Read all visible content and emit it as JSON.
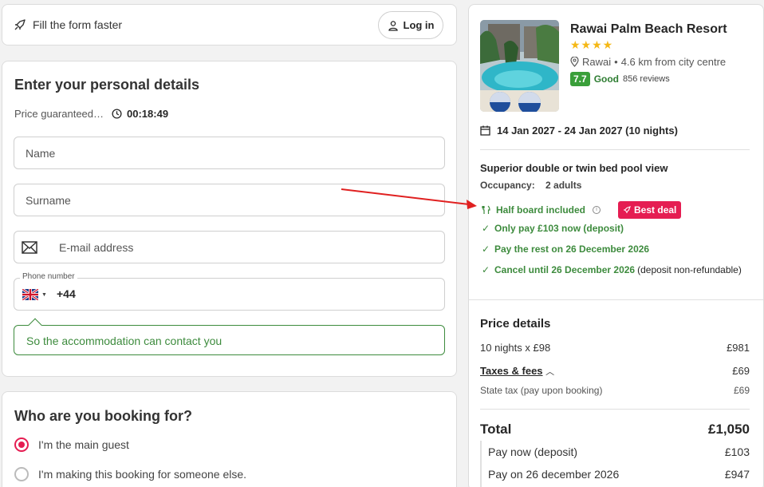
{
  "fill_form": {
    "text": "Fill the form faster",
    "login_label": "Log in"
  },
  "personal": {
    "title": "Enter your personal details",
    "price_guaranteed": "Price guaranteed…",
    "timer": "00:18:49",
    "name_placeholder": "Name",
    "surname_placeholder": "Surname",
    "email_placeholder": "E-mail address",
    "phone_label": "Phone number",
    "phone_code": "+44",
    "contact_tip": "So the accommodation can contact you"
  },
  "booking_for": {
    "title": "Who are you booking for?",
    "options": [
      "I'm the main guest",
      "I'm making this booking for someone else."
    ],
    "selected": 0
  },
  "hotel": {
    "name": "Rawai Palm Beach Resort",
    "stars": "★★★★",
    "star_count": 4,
    "location": "Rawai",
    "distance": "4.6 km from city centre",
    "score": "7.7",
    "score_word": "Good",
    "reviews": "856 reviews",
    "dates": "14 Jan 2027 - 24 Jan 2027 (10 nights)"
  },
  "room": {
    "name": "Superior double or twin bed pool view",
    "occupancy_label": "Occupancy:",
    "occupancy_value": "2 adults",
    "half_board": "Half board included",
    "best_deal": "Best deal",
    "features": [
      {
        "text": "Only pay £103 now (deposit)",
        "extra": ""
      },
      {
        "text": "Pay the rest on 26 December 2026",
        "extra": ""
      },
      {
        "text": "Cancel until 26 December 2026",
        "extra": "(deposit non-refundable)"
      }
    ]
  },
  "price": {
    "title": "Price details",
    "nights_label": "10 nights x £98",
    "nights_value": "£981",
    "taxes_label": "Taxes & fees",
    "taxes_value": "£69",
    "state_tax_label": "State tax (pay upon booking)",
    "state_tax_value": "£69",
    "total_label": "Total",
    "total_value": "£1,050",
    "pay_now_label": "Pay now (deposit)",
    "pay_now_value": "£103",
    "pay_later_label": "Pay on 26 december 2026",
    "pay_later_value": "£947"
  },
  "colors": {
    "accent": "#e51d52",
    "green": "#3d8b3d",
    "score_bg": "#3a9f3a",
    "star": "#f5b816",
    "arrow": "#e02020"
  }
}
